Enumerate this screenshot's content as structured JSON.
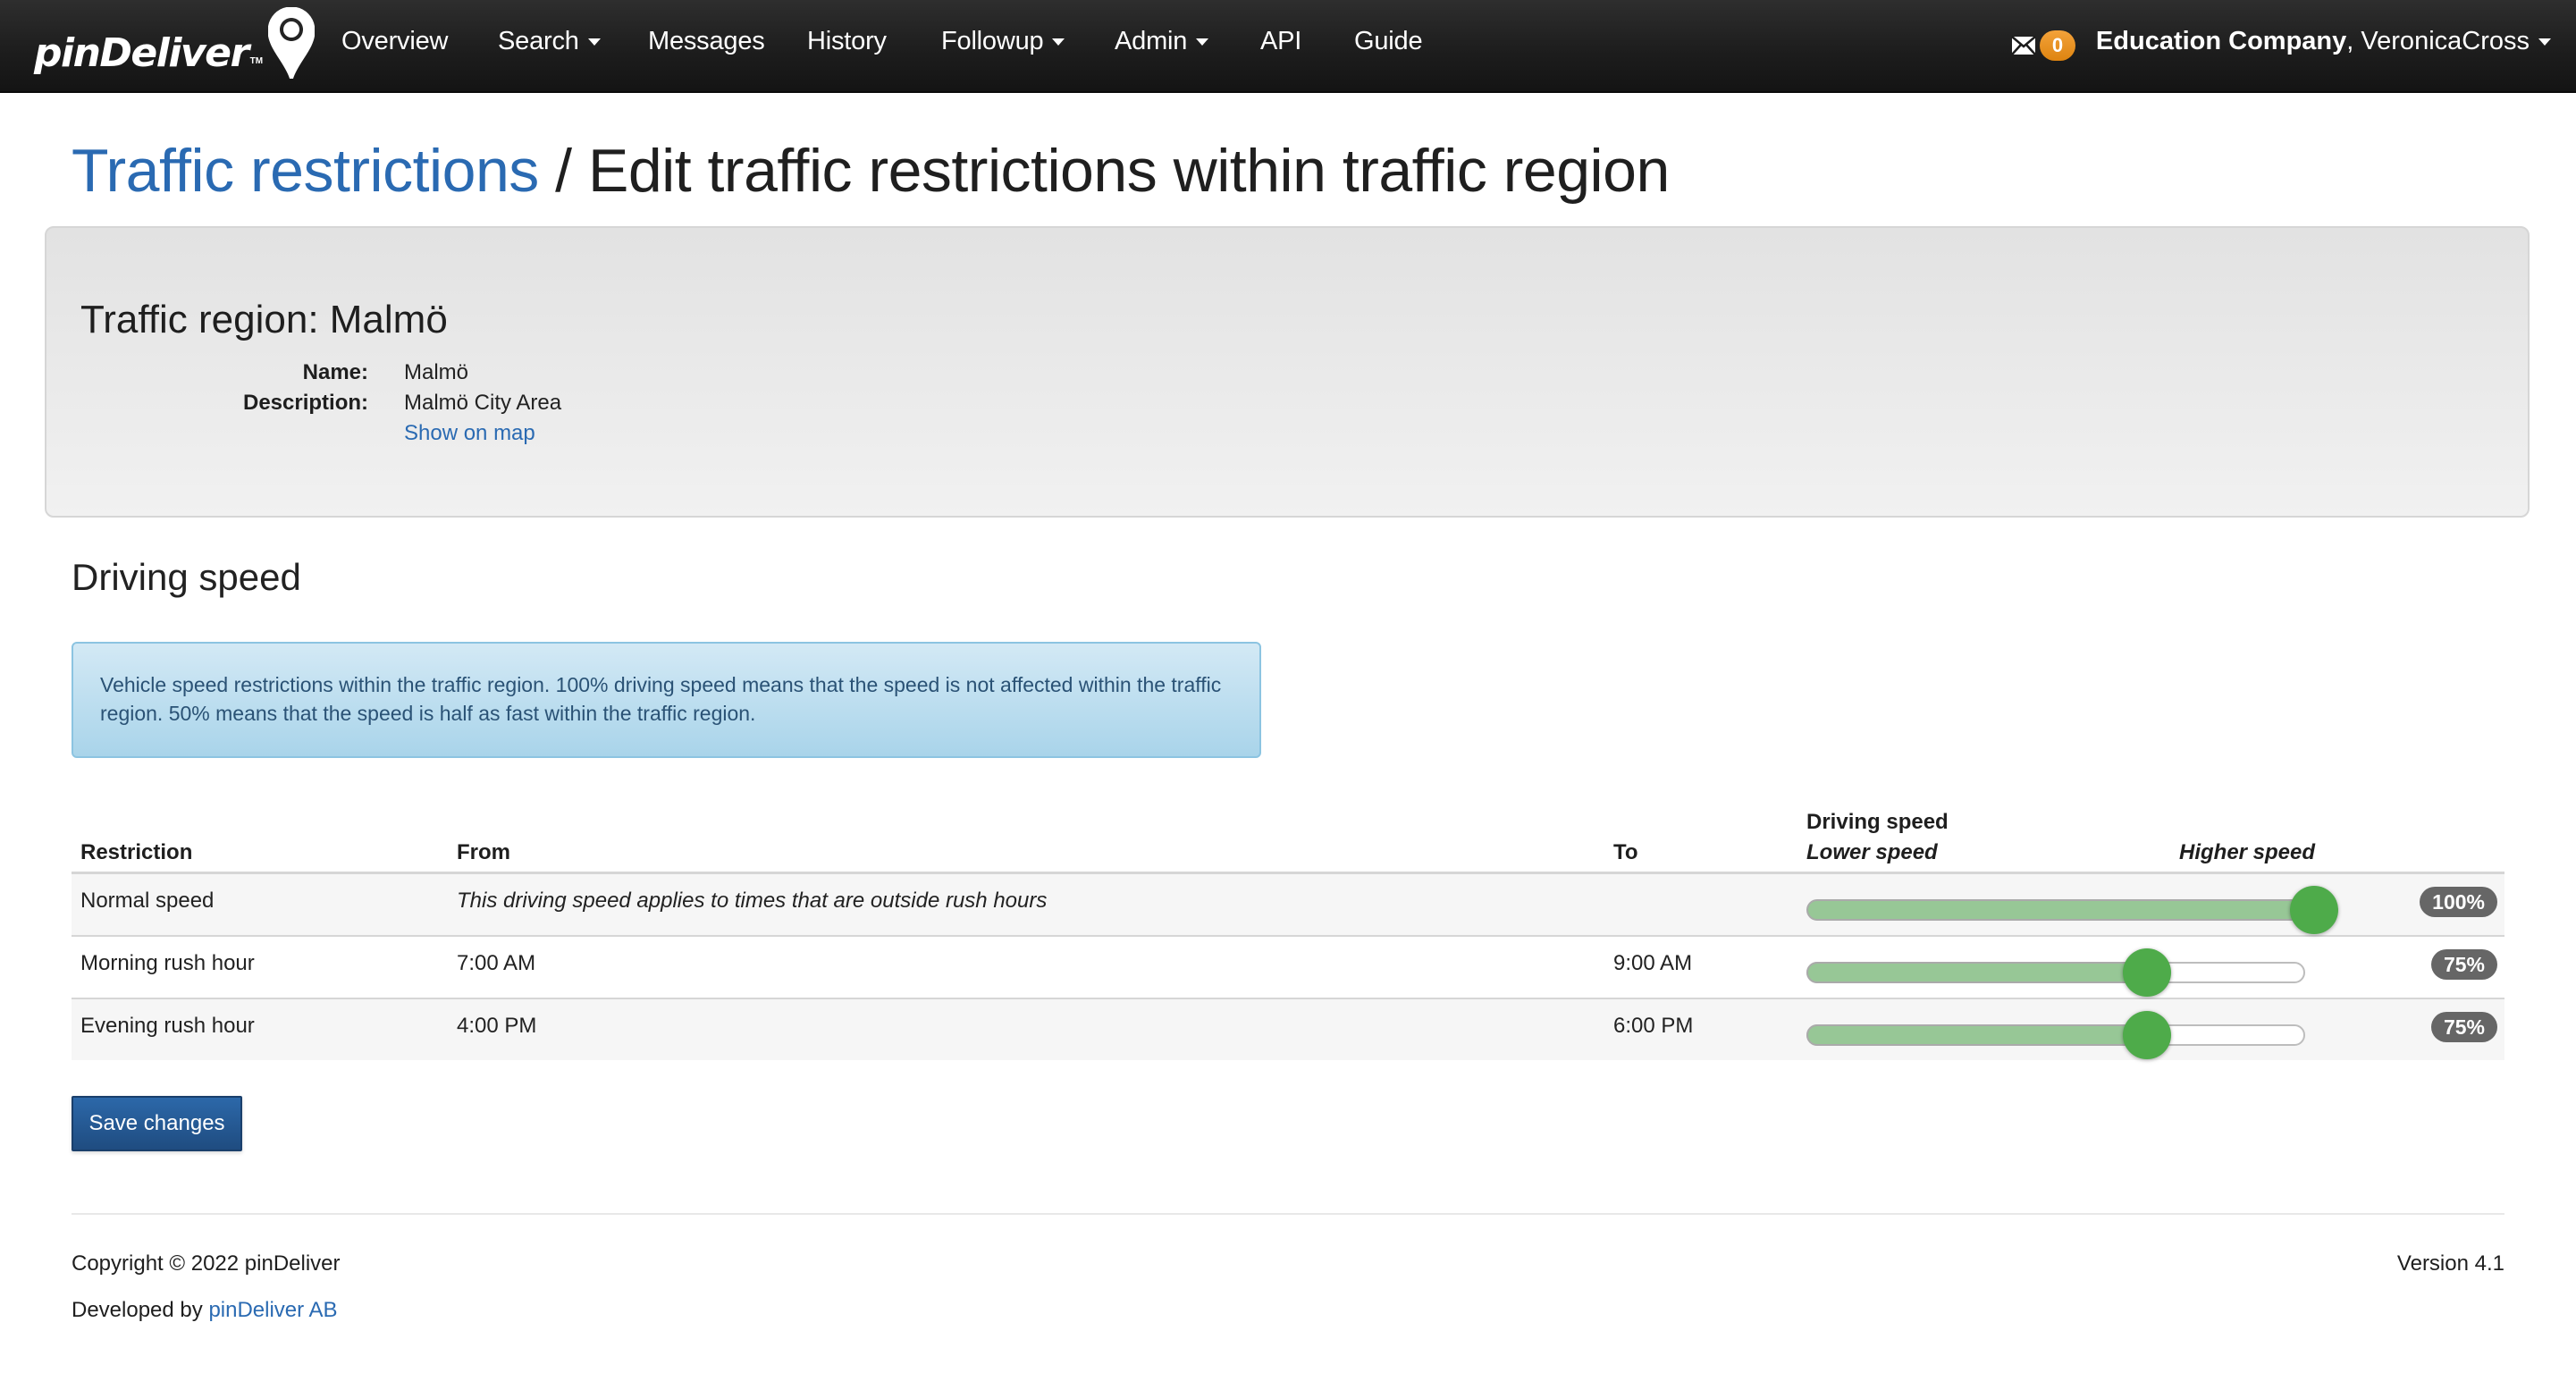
{
  "navbar": {
    "brand": "pinDeliver",
    "brand_tm": "TM",
    "items": [
      {
        "label": "Overview",
        "dropdown": false
      },
      {
        "label": "Search",
        "dropdown": true
      },
      {
        "label": "Messages",
        "dropdown": false
      },
      {
        "label": "History",
        "dropdown": false
      },
      {
        "label": "Followup",
        "dropdown": true
      },
      {
        "label": "Admin",
        "dropdown": true
      },
      {
        "label": "API",
        "dropdown": false
      },
      {
        "label": "Guide",
        "dropdown": false
      }
    ],
    "message_count": "0",
    "company": "Education Company",
    "user_separator": ", ",
    "user": "VeronicaCross",
    "icons": {
      "messages": "envelope-icon",
      "logo": "map-pin-icon",
      "dropdown": "caret-down-icon"
    }
  },
  "page": {
    "breadcrumb_link": "Traffic restrictions",
    "breadcrumb_separator": " / ",
    "title": "Edit traffic restrictions within traffic region"
  },
  "region": {
    "heading": "Traffic region: Malmö",
    "fields": [
      {
        "label": "Name:",
        "value": "Malmö"
      },
      {
        "label": "Description:",
        "value": "Malmö City Area"
      }
    ],
    "map_link": "Show on map"
  },
  "driving_speed": {
    "section_title": "Driving speed",
    "info": "Vehicle speed restrictions within the traffic region. 100% driving speed means that the speed is not affected within the traffic region. 50% means that the speed is half as fast within the traffic region.",
    "table": {
      "headers": {
        "restriction": "Restriction",
        "from": "From",
        "to": "To",
        "speed": "Driving speed",
        "lower": "Lower speed",
        "higher": "Higher speed"
      },
      "rows": [
        {
          "restriction": "Normal speed",
          "from": "This driving speed applies to times that are outside rush hours",
          "from_italic": true,
          "to": "",
          "speed_percent": 100,
          "speed_label": "100%"
        },
        {
          "restriction": "Morning rush hour",
          "from": "7:00 AM",
          "from_italic": false,
          "to": "9:00 AM",
          "speed_percent": 75,
          "speed_label": "75%"
        },
        {
          "restriction": "Evening rush hour",
          "from": "4:00 PM",
          "from_italic": false,
          "to": "6:00 PM",
          "speed_percent": 75,
          "speed_label": "75%"
        }
      ]
    },
    "save_label": "Save changes"
  },
  "footer": {
    "copyright": "Copyright © 2022 pinDeliver",
    "developed_prefix": "Developed by ",
    "developed_link": "pinDeliver AB",
    "version": "Version 4.1"
  },
  "colors": {
    "link": "#2a6ab2",
    "badge_orange": "#e8901e",
    "slider_green": "#4eab4a",
    "slider_fill": "#97c796",
    "pct_badge": "#666666",
    "primary_button": "#245a96"
  }
}
